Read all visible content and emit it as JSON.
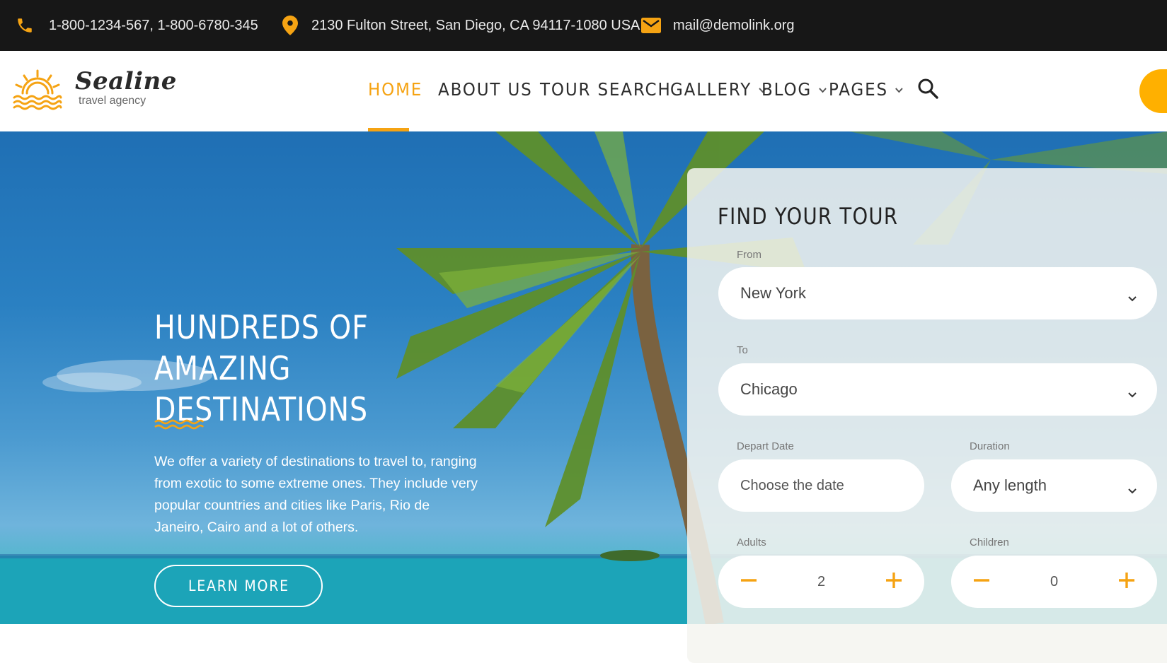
{
  "topbar": {
    "phones": "1-800-1234-567,  1-800-6780-345",
    "address": "2130 Fulton Street, San Diego, CA 94117-1080 USA",
    "email": "mail@demolink.org"
  },
  "logo": {
    "name": "Sealine",
    "tagline": "travel agency"
  },
  "nav": {
    "items": [
      {
        "label": "HOME",
        "active": true
      },
      {
        "label": "ABOUT US"
      },
      {
        "label": "TOUR SEARCH"
      },
      {
        "label": "GALLERY",
        "dropdown": true
      },
      {
        "label": "BLOG",
        "dropdown": true
      },
      {
        "label": "PAGES",
        "dropdown": true
      }
    ]
  },
  "hero": {
    "title_line1": "HUNDREDS OF AMAZING",
    "title_line2": "DESTINATIONS",
    "text": "We offer a variety of destinations to travel to, ranging from exotic to some extreme ones. They include very popular countries and cities like Paris, Rio de Janeiro, Cairo and a lot of others.",
    "button": "LEARN MORE"
  },
  "search": {
    "title": "FIND YOUR TOUR",
    "from_label": "From",
    "from_value": "New York",
    "to_label": "To",
    "to_value": "Chicago",
    "depart_label": "Depart Date",
    "depart_placeholder": "Choose the date",
    "duration_label": "Duration",
    "duration_value": "Any length",
    "adults_label": "Adults",
    "adults_value": "2",
    "children_label": "Children",
    "children_value": "0"
  },
  "colors": {
    "accent": "#f5a313",
    "topbar": "#171717",
    "text": "#2d2d2d"
  }
}
